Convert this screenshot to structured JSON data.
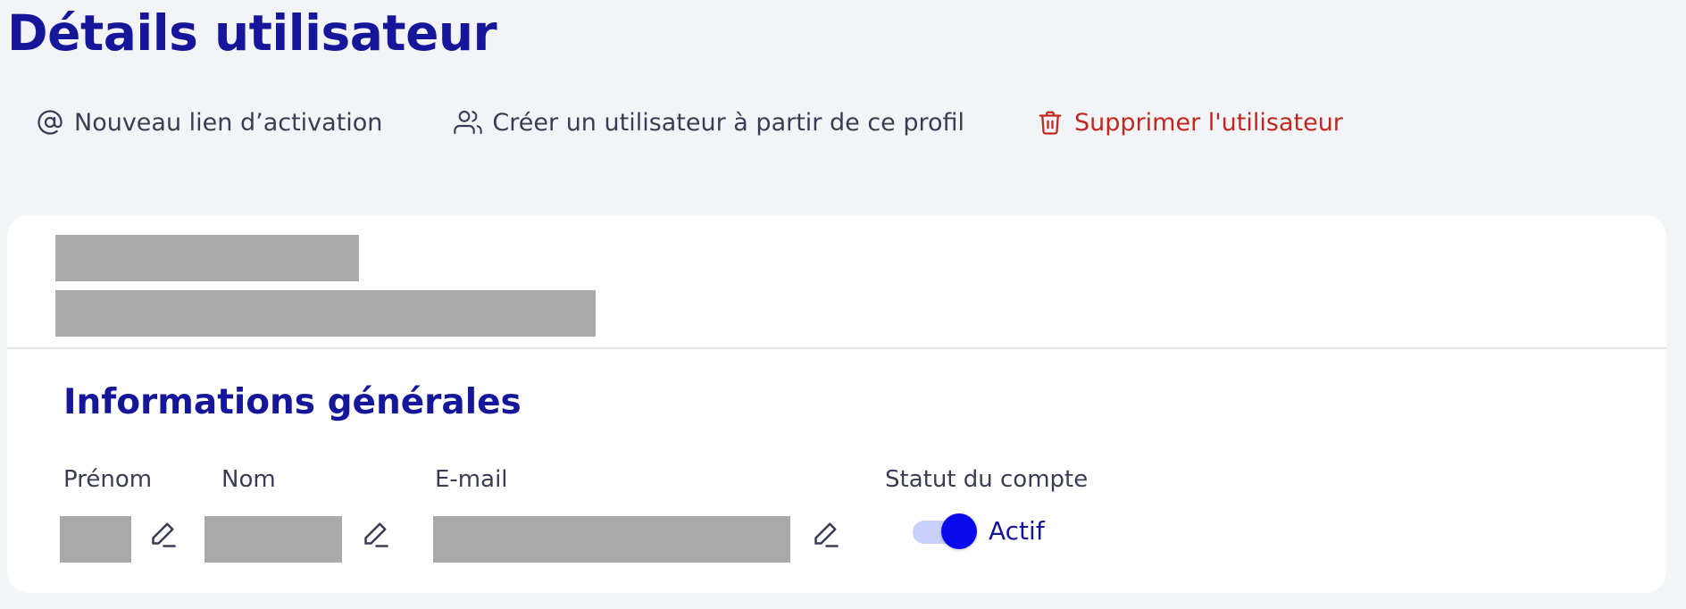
{
  "page": {
    "title": "Détails utilisateur"
  },
  "actions": [
    {
      "label": "Nouveau lien d’activation",
      "icon": "at-sign-icon"
    },
    {
      "label": "Créer un utilisateur à partir de ce profil",
      "icon": "users-icon"
    },
    {
      "label": "Supprimer l'utilisateur",
      "icon": "trash-icon"
    }
  ],
  "colors": {
    "title": "#16169a",
    "danger": "#c0271e",
    "toggle_on": "#0a0aeb",
    "toggle_track": "#c9d0fb",
    "background": "#f3f4f8"
  },
  "general_info": {
    "title": "Informations générales",
    "first_name_label": "Prénom",
    "last_name_label": "Nom",
    "email_label": "E-mail",
    "status_label": "Statut du compte",
    "status_value": "Actif",
    "status_enabled": true
  }
}
